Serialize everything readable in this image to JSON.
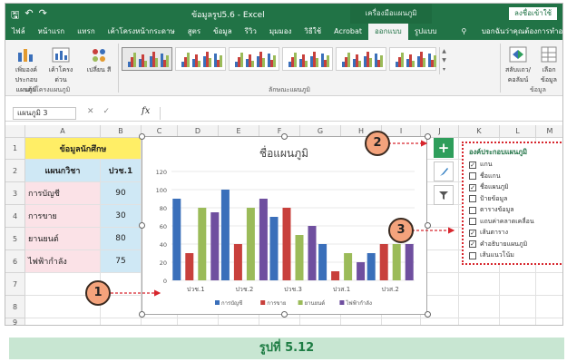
{
  "titlebar": {
    "qat": [
      "🖫",
      "↶",
      "↷"
    ],
    "title": "ข้อมูลรูป5.6 - Excel",
    "context_label": "เครื่องมือแผนภูมิ",
    "sign_in": "ลงชื่อเข้าใช้"
  },
  "tabs": [
    "ไฟล์",
    "หน้าแรก",
    "แทรก",
    "เค้าโครงหน้ากระดาษ",
    "สูตร",
    "ข้อมูล",
    "รีวิว",
    "มุมมอง",
    "วิธีใช้",
    "Acrobat",
    "ออกแบบ",
    "รูปแบบ"
  ],
  "tabs_active": "ออกแบบ",
  "tell_me": "บอกฉันว่าคุณต้องการทำอะไร",
  "ribbon": {
    "add_element": "เพิ่มองค์ประกอบ แผนภูมิ",
    "quick_layout": "เค้าโครง ด่วน",
    "change_colors": "เปลี่ยน สี",
    "group_layout": "เค้าโครงแผนภูมิ",
    "group_styles": "ลักษณะแผนภูมิ",
    "switch_row_col": "สลับแถว/คอลัมน์",
    "select_data": "เลือก ข้อมูล",
    "group_data": "ข้อมูล"
  },
  "formula_bar": {
    "name_box": "แผนภูมิ 3",
    "fx": "fx"
  },
  "columns": [
    "A",
    "B",
    "C",
    "D",
    "E",
    "F",
    "G",
    "H",
    "I",
    "J",
    "K",
    "L",
    "M"
  ],
  "rows": [
    "1",
    "2",
    "3",
    "4",
    "5",
    "6",
    "7",
    "8",
    "9"
  ],
  "sheet": {
    "title": "ข้อมูลนักศึกษ",
    "head_name": "แผนกวิชา",
    "head_val": "ปวช.1",
    "names": [
      "การบัญชี",
      "การขาย",
      "ยานยนต์",
      "ไฟฟ้ากำลัง"
    ],
    "values": [
      "90",
      "30",
      "80",
      "75"
    ]
  },
  "chart_data": {
    "type": "bar",
    "title": "ชื่อแผนภูมิ",
    "categories": [
      "ปวช.1",
      "ปวช.2",
      "ปวช.3",
      "ปวส.1",
      "ปวส.2"
    ],
    "ylim": [
      0,
      120
    ],
    "yticks": [
      "0",
      "20",
      "40",
      "60",
      "80",
      "100",
      "120"
    ],
    "series": [
      {
        "name": "การบัญชี",
        "color": "#3a6fba",
        "values": [
          90,
          100,
          70,
          40,
          30
        ]
      },
      {
        "name": "การขาย",
        "color": "#c8403c",
        "values": [
          30,
          40,
          80,
          10,
          40
        ]
      },
      {
        "name": "ยานยนต์",
        "color": "#9bbb59",
        "values": [
          80,
          80,
          50,
          30,
          40
        ]
      },
      {
        "name": "ไฟฟ้ากำลัง",
        "color": "#6f4f9f",
        "values": [
          75,
          90,
          60,
          20,
          40
        ]
      }
    ],
    "legend": "bottom",
    "grid": true
  },
  "panel": {
    "title": "องค์ประกอบแผนภูมิ",
    "items": [
      {
        "label": "แกน",
        "checked": true
      },
      {
        "label": "ชื่อแกน",
        "checked": false
      },
      {
        "label": "ชื่อแผนภูมิ",
        "checked": true
      },
      {
        "label": "ป้ายข้อมูล",
        "checked": false
      },
      {
        "label": "ตารางข้อมูล",
        "checked": false
      },
      {
        "label": "แถบค่าคลาดเคลื่อน",
        "checked": false
      },
      {
        "label": "เส้นตาราง",
        "checked": true
      },
      {
        "label": "คำอธิบายแผนภูมิ",
        "checked": true
      },
      {
        "label": "เส้นแนวโน้ม",
        "checked": false
      }
    ]
  },
  "callouts": [
    "1",
    "2",
    "3"
  ],
  "caption": "รูปที่ 5.12"
}
